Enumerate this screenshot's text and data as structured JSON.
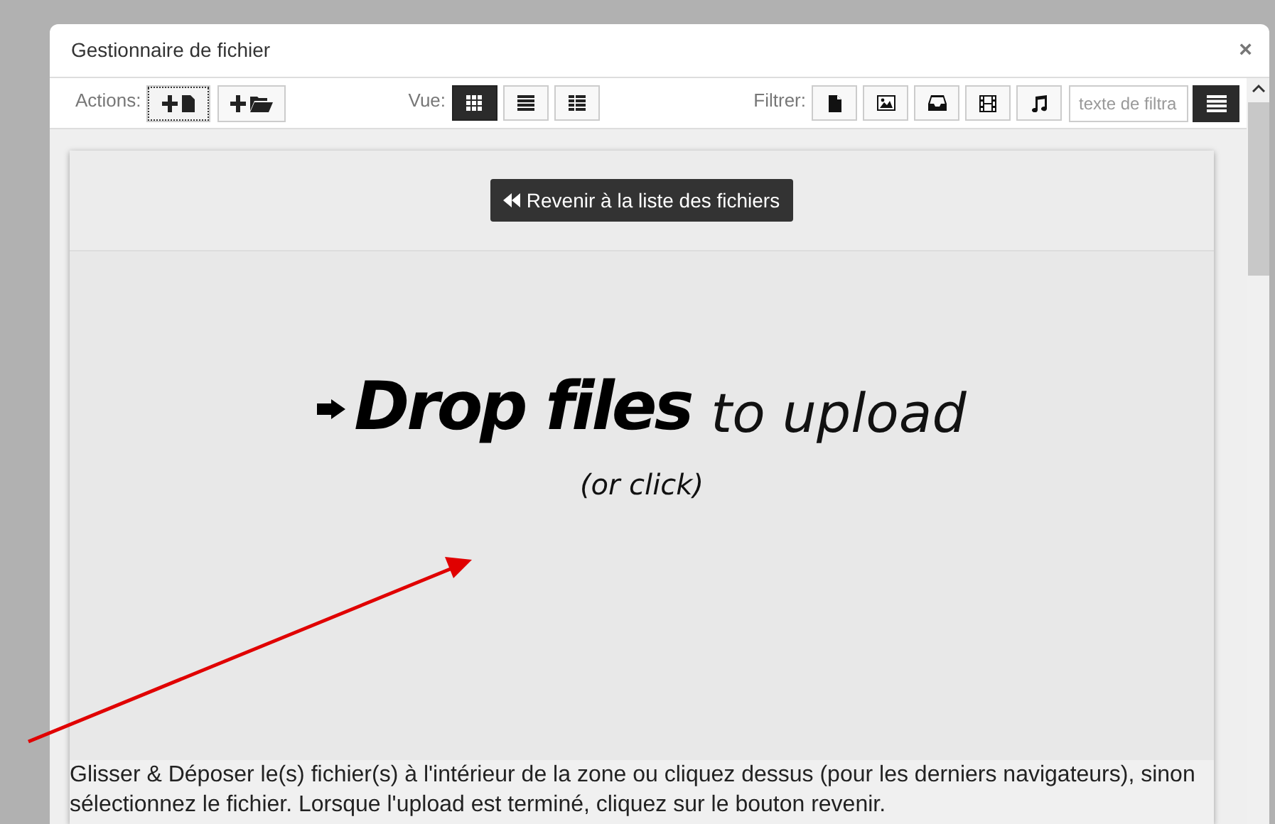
{
  "window": {
    "title": "Gestionnaire de fichier",
    "close": "×"
  },
  "toolbar": {
    "actions_label": "Actions:",
    "actions": [
      {
        "kind": "new-file",
        "focused": true
      },
      {
        "kind": "new-folder",
        "focused": false
      }
    ],
    "view_label": "Vue:",
    "views": [
      {
        "kind": "grid",
        "selected": true
      },
      {
        "kind": "list",
        "selected": false
      },
      {
        "kind": "details",
        "selected": false
      }
    ],
    "filter_label": "Filtrer:",
    "filters": [
      {
        "kind": "file"
      },
      {
        "kind": "image"
      },
      {
        "kind": "archive"
      },
      {
        "kind": "video"
      },
      {
        "kind": "audio"
      }
    ],
    "filter_field": {
      "placeholder": "texte de filtra"
    }
  },
  "back_button": "Revenir à la liste des fichiers",
  "drop_zone": {
    "headline": "Drop files",
    "tail": "to upload",
    "hint": "(or click)"
  },
  "help_text": "Glisser & Déposer le(s) fichier(s) à l'intérieur de la zone ou cliquez dessus (pour les derniers navigateurs), sinon sélectionnez le fichier. Lorsque l'upload est terminé, cliquez sur le bouton revenir."
}
